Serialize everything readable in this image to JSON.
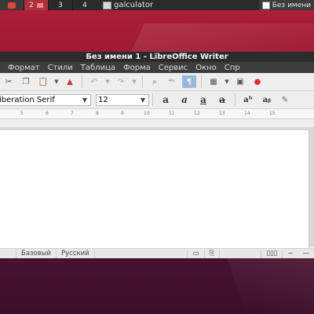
{
  "taskbar": {
    "workspaces": [
      "2",
      "3",
      "4"
    ],
    "task_calc": "galculator",
    "task_writer": "Без имени"
  },
  "window": {
    "title": "Без имени 1 - LibreOffice Writer",
    "menu": [
      "Формат",
      "Стили",
      "Таблица",
      "Форма",
      "Сервис",
      "Окно",
      "Спр"
    ]
  },
  "format_bar": {
    "font_name": "iberation Serif",
    "font_size": "12"
  },
  "ruler_ticks": [
    "5",
    "6",
    "7",
    "8",
    "9",
    "10",
    "11",
    "12",
    "13",
    "14",
    "15"
  ],
  "status": {
    "style": "Базовый",
    "language": "Русский"
  }
}
